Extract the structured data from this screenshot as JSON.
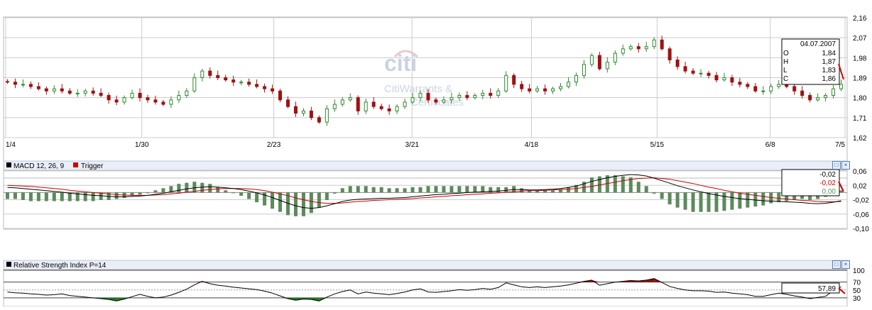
{
  "watermark": {
    "brand": "citi",
    "line1": "CitiWarrants &",
    "line2": "Certificates"
  },
  "colors": {
    "up_fill": "#ffffff",
    "up_stroke": "#2e8b2e",
    "down": "#a01010",
    "wick": "#000000",
    "macd_line": "#000000",
    "trigger_line": "#cc0000",
    "hist_pos": "#5c8a5c",
    "hist_neg": "#5c8a5c",
    "rsi_line": "#000000",
    "rsi_over": "#8b0f0f",
    "rsi_under": "#1f7a1f",
    "grid": "#cccccc",
    "header_bg": "#e9eef7",
    "accent": "#cc0000"
  },
  "price_panel": {
    "y_ticks": [
      "2,16",
      "2,07",
      "1,98",
      "1,89",
      "1,80",
      "1,71",
      "1,62"
    ],
    "x_ticks": [
      "1/4",
      "1/30",
      "2/23",
      "3/21",
      "4/18",
      "5/15",
      "6/8",
      "7/5"
    ],
    "tooltip": {
      "date": "04.07.2007",
      "labels": [
        "O",
        "H",
        "L",
        "C"
      ],
      "values": [
        "1,84",
        "1,87",
        "1,83",
        "1,86"
      ]
    }
  },
  "macd_panel": {
    "title": "MACD 12, 26, 9",
    "trigger_label": "Trigger",
    "y_ticks": [
      "0,06",
      "0,02",
      "-0,02",
      "-0,06",
      "-0,10"
    ],
    "values": {
      "macd": "-0,02",
      "trigger": "-0,02",
      "hist": "0,00"
    }
  },
  "rsi_panel": {
    "title": "Relative Strength Index P=14",
    "y_ticks": [
      "100",
      "70",
      "50",
      "30"
    ],
    "value": "57,89"
  },
  "chart_data": {
    "type": "candlestick",
    "x_dates": [
      "1/4",
      "1/30",
      "2/23",
      "3/21",
      "4/18",
      "5/15",
      "6/8",
      "7/5"
    ],
    "ylim": [
      1.62,
      2.16
    ],
    "grid": true,
    "ohlc_last": {
      "date": "04.07.2007",
      "open": 1.84,
      "high": 1.87,
      "low": 1.83,
      "close": 1.86
    },
    "close": [
      1.87,
      1.86,
      1.86,
      1.85,
      1.84,
      1.83,
      1.84,
      1.83,
      1.82,
      1.82,
      1.83,
      1.82,
      1.81,
      1.79,
      1.78,
      1.8,
      1.82,
      1.8,
      1.79,
      1.78,
      1.77,
      1.79,
      1.81,
      1.83,
      1.89,
      1.92,
      1.9,
      1.89,
      1.88,
      1.87,
      1.87,
      1.86,
      1.85,
      1.84,
      1.83,
      1.79,
      1.76,
      1.73,
      1.74,
      1.71,
      1.69,
      1.75,
      1.77,
      1.79,
      1.8,
      1.74,
      1.78,
      1.76,
      1.75,
      1.74,
      1.76,
      1.78,
      1.8,
      1.82,
      1.79,
      1.78,
      1.79,
      1.8,
      1.81,
      1.8,
      1.81,
      1.82,
      1.81,
      1.83,
      1.9,
      1.86,
      1.84,
      1.83,
      1.84,
      1.83,
      1.84,
      1.85,
      1.87,
      1.9,
      1.95,
      1.99,
      1.93,
      1.96,
      2.0,
      2.02,
      2.03,
      2.02,
      2.03,
      2.06,
      2.02,
      1.97,
      1.94,
      1.92,
      1.91,
      1.91,
      1.9,
      1.88,
      1.89,
      1.87,
      1.86,
      1.85,
      1.83,
      1.83,
      1.85,
      1.86,
      1.85,
      1.83,
      1.81,
      1.79,
      1.8,
      1.81,
      1.84,
      1.86
    ],
    "macd": [
      0.014,
      0.013,
      0.011,
      0.009,
      0.007,
      0.005,
      0.003,
      0.001,
      -0.002,
      -0.004,
      -0.006,
      -0.008,
      -0.009,
      -0.011,
      -0.012,
      -0.012,
      -0.011,
      -0.01,
      -0.008,
      -0.005,
      -0.002,
      0.002,
      0.006,
      0.01,
      0.013,
      0.015,
      0.016,
      0.015,
      0.013,
      0.011,
      0.008,
      0.004,
      -0.001,
      -0.007,
      -0.014,
      -0.022,
      -0.03,
      -0.037,
      -0.042,
      -0.044,
      -0.042,
      -0.037,
      -0.031,
      -0.025,
      -0.021,
      -0.019,
      -0.018,
      -0.017,
      -0.016,
      -0.016,
      -0.015,
      -0.014,
      -0.012,
      -0.01,
      -0.008,
      -0.006,
      -0.005,
      -0.003,
      -0.002,
      0.0,
      0.001,
      0.002,
      0.003,
      0.004,
      0.006,
      0.008,
      0.008,
      0.007,
      0.007,
      0.008,
      0.009,
      0.011,
      0.014,
      0.018,
      0.024,
      0.031,
      0.036,
      0.041,
      0.045,
      0.048,
      0.05,
      0.049,
      0.046,
      0.04,
      0.033,
      0.026,
      0.019,
      0.013,
      0.007,
      0.002,
      -0.003,
      -0.007,
      -0.011,
      -0.014,
      -0.017,
      -0.019,
      -0.021,
      -0.023,
      -0.024,
      -0.025,
      -0.026,
      -0.027,
      -0.028,
      -0.03,
      -0.031,
      -0.03,
      -0.027,
      -0.023
    ],
    "trigger": [
      0.02,
      0.019,
      0.018,
      0.017,
      0.015,
      0.013,
      0.011,
      0.009,
      0.006,
      0.004,
      0.002,
      -0.0,
      -0.002,
      -0.004,
      -0.006,
      -0.007,
      -0.008,
      -0.008,
      -0.008,
      -0.007,
      -0.006,
      -0.004,
      -0.002,
      0.001,
      0.003,
      0.006,
      0.008,
      0.01,
      0.011,
      0.011,
      0.011,
      0.01,
      0.008,
      0.005,
      0.001,
      -0.004,
      -0.009,
      -0.015,
      -0.02,
      -0.025,
      -0.028,
      -0.03,
      -0.03,
      -0.029,
      -0.027,
      -0.025,
      -0.024,
      -0.022,
      -0.021,
      -0.02,
      -0.019,
      -0.018,
      -0.017,
      -0.015,
      -0.014,
      -0.012,
      -0.011,
      -0.009,
      -0.008,
      -0.006,
      -0.005,
      -0.004,
      -0.002,
      -0.001,
      0.001,
      0.002,
      0.004,
      0.005,
      0.005,
      0.006,
      0.007,
      0.008,
      0.009,
      0.011,
      0.014,
      0.017,
      0.021,
      0.025,
      0.029,
      0.033,
      0.036,
      0.039,
      0.04,
      0.041,
      0.039,
      0.037,
      0.033,
      0.029,
      0.025,
      0.02,
      0.015,
      0.011,
      0.006,
      0.002,
      -0.002,
      -0.005,
      -0.008,
      -0.011,
      -0.014,
      -0.016,
      -0.018,
      -0.02,
      -0.022,
      -0.023,
      -0.025,
      -0.026,
      -0.026,
      -0.025
    ],
    "rsi": [
      45,
      43,
      42,
      40,
      39,
      37,
      38,
      40,
      36,
      34,
      32,
      30,
      28,
      26,
      22,
      27,
      33,
      39,
      34,
      30,
      32,
      37,
      44,
      52,
      63,
      72,
      66,
      62,
      60,
      57,
      55,
      53,
      51,
      47,
      42,
      35,
      28,
      24,
      27,
      26,
      22,
      32,
      40,
      46,
      50,
      40,
      45,
      42,
      40,
      38,
      41,
      45,
      50,
      53,
      45,
      44,
      46,
      48,
      51,
      49,
      51,
      54,
      52,
      56,
      68,
      63,
      58,
      56,
      58,
      56,
      58,
      60,
      63,
      67,
      72,
      75,
      62,
      66,
      70,
      72,
      74,
      73,
      75,
      79,
      69,
      59,
      54,
      50,
      48,
      48,
      47,
      44,
      45,
      42,
      40,
      38,
      34,
      34,
      38,
      42,
      39,
      35,
      32,
      28,
      31,
      34,
      48,
      58
    ]
  }
}
